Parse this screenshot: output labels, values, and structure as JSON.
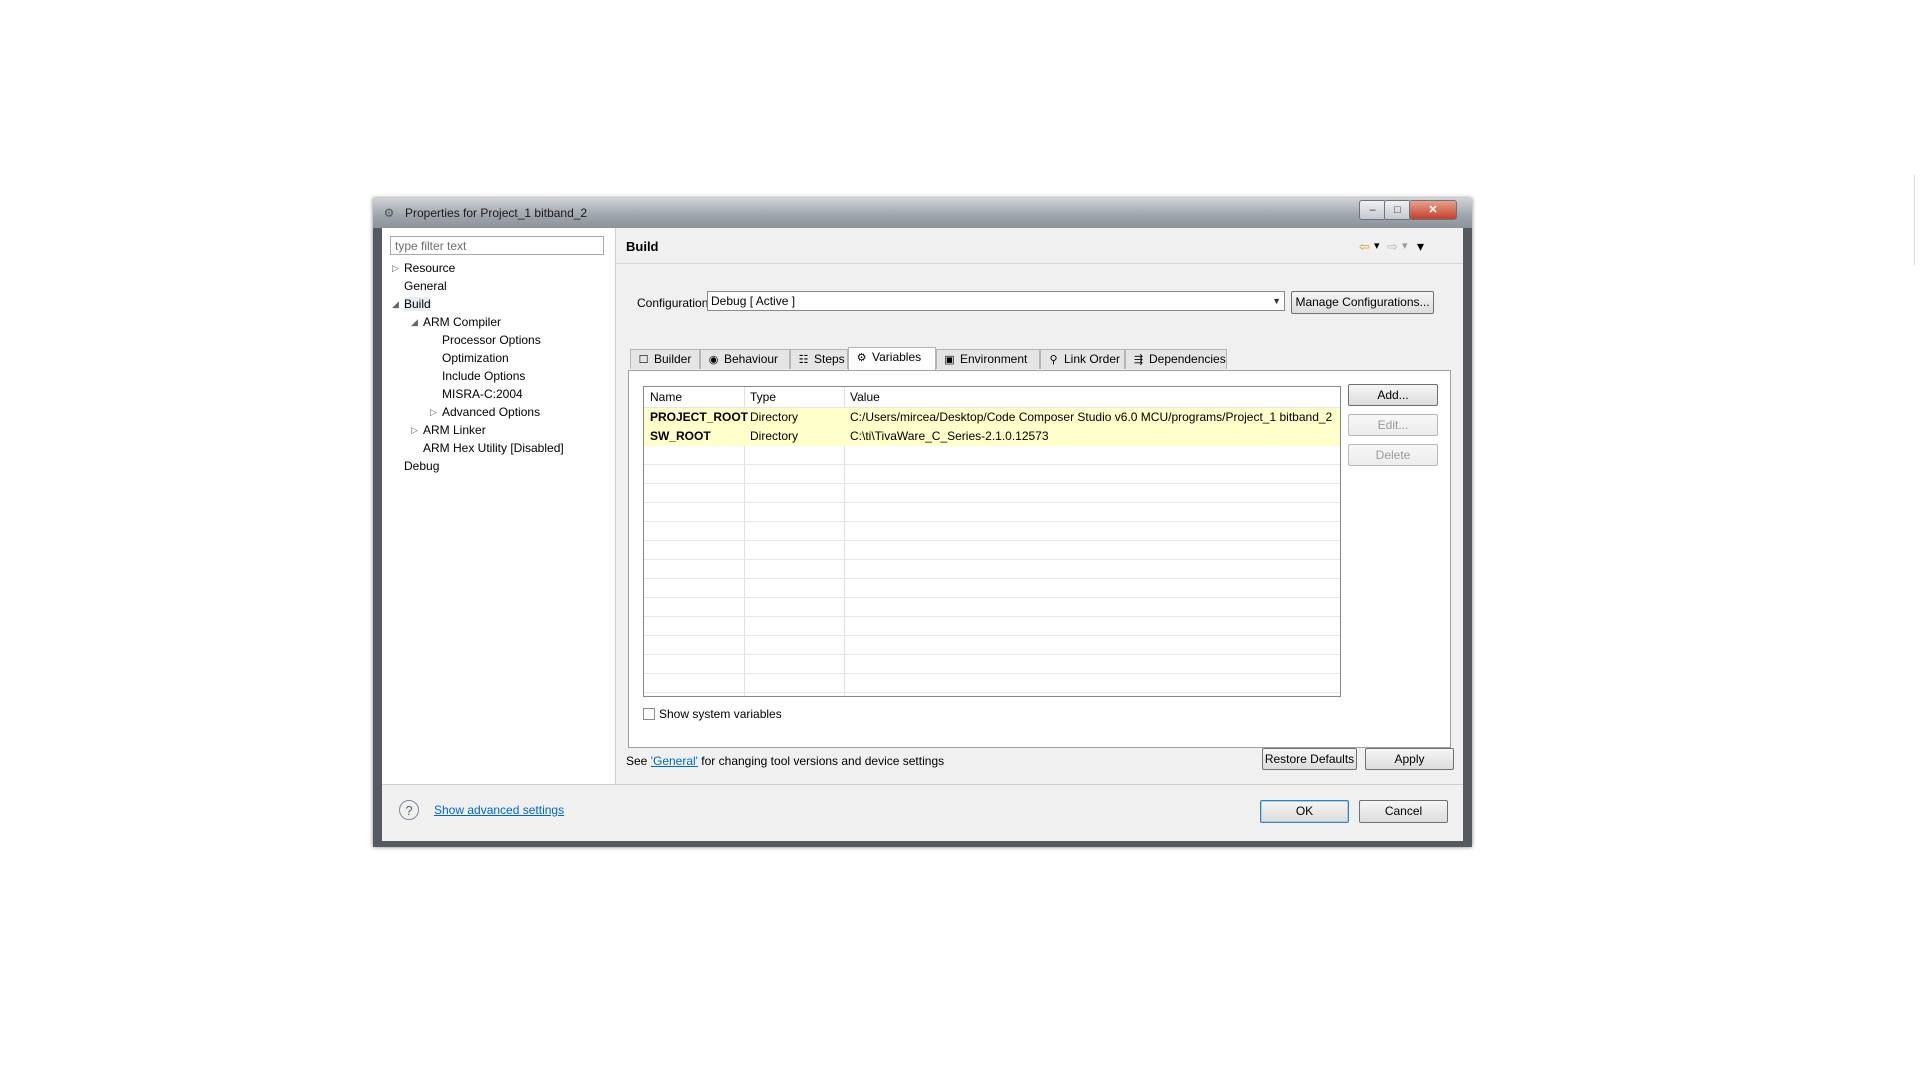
{
  "window": {
    "title": "Properties for Project_1 bitband_2",
    "min_glyph": "–",
    "max_glyph": "□",
    "close_glyph": "✕",
    "app_icon": "gear-icon"
  },
  "filter": {
    "placeholder": "type filter text"
  },
  "tree": [
    {
      "label": "Resource",
      "toggle": "▷"
    },
    {
      "label": "General",
      "toggle": ""
    },
    {
      "label": "Build",
      "toggle": "◢",
      "selected": true
    },
    {
      "label": "ARM Compiler",
      "toggle": "◢"
    },
    {
      "label": "Processor Options",
      "toggle": ""
    },
    {
      "label": "Optimization",
      "toggle": ""
    },
    {
      "label": "Include Options",
      "toggle": ""
    },
    {
      "label": "MISRA-C:2004",
      "toggle": ""
    },
    {
      "label": "Advanced Options",
      "toggle": "▷"
    },
    {
      "label": "ARM Linker",
      "toggle": "▷"
    },
    {
      "label": "ARM Hex Utility  [Disabled]",
      "toggle": ""
    },
    {
      "label": "Debug",
      "toggle": ""
    }
  ],
  "page": {
    "title": "Build"
  },
  "nav": {
    "back": "⇦",
    "back_menu": "▾",
    "forward": "⇨",
    "forward_menu": "▾",
    "view_menu": "▾"
  },
  "configuration": {
    "label": "Configuration:",
    "value": "Debug  [ Active ]",
    "manage": "Manage Configurations..."
  },
  "tabs": [
    {
      "label": "Builder",
      "icon": "☐",
      "icon_name": "builder-icon"
    },
    {
      "label": "Behaviour",
      "icon": "◉",
      "icon_name": "behaviour-icon"
    },
    {
      "label": "Steps",
      "icon": "☷",
      "icon_name": "steps-icon"
    },
    {
      "label": "Variables",
      "icon": "⚙",
      "icon_name": "variables-icon",
      "active": true
    },
    {
      "label": "Environment",
      "icon": "▣",
      "icon_name": "environment-icon"
    },
    {
      "label": "Link Order",
      "icon": "⚲",
      "icon_name": "link-order-icon"
    },
    {
      "label": "Dependencies",
      "icon": "⇶",
      "icon_name": "dependencies-icon"
    }
  ],
  "table": {
    "headers": [
      "Name",
      "Type",
      "Value"
    ],
    "rows": [
      {
        "name": "PROJECT_ROOT",
        "type": "Directory",
        "value": "C:/Users/mircea/Desktop/Code Composer Studio v6.0 MCU/programs/Project_1 bitband_2"
      },
      {
        "name": "SW_ROOT",
        "type": "Directory",
        "value": "C:\\ti\\TivaWare_C_Series-2.1.0.12573"
      }
    ]
  },
  "side_buttons": {
    "add": "Add...",
    "edit": "Edit...",
    "delete": "Delete"
  },
  "show_system": "Show system variables",
  "see": {
    "prefix": "See ",
    "link": "'General'",
    "suffix": " for changing tool versions and device settings"
  },
  "restore": "Restore Defaults",
  "apply": "Apply",
  "help_glyph": "?",
  "advanced": "Show advanced settings",
  "ok": "OK",
  "cancel": "Cancel"
}
